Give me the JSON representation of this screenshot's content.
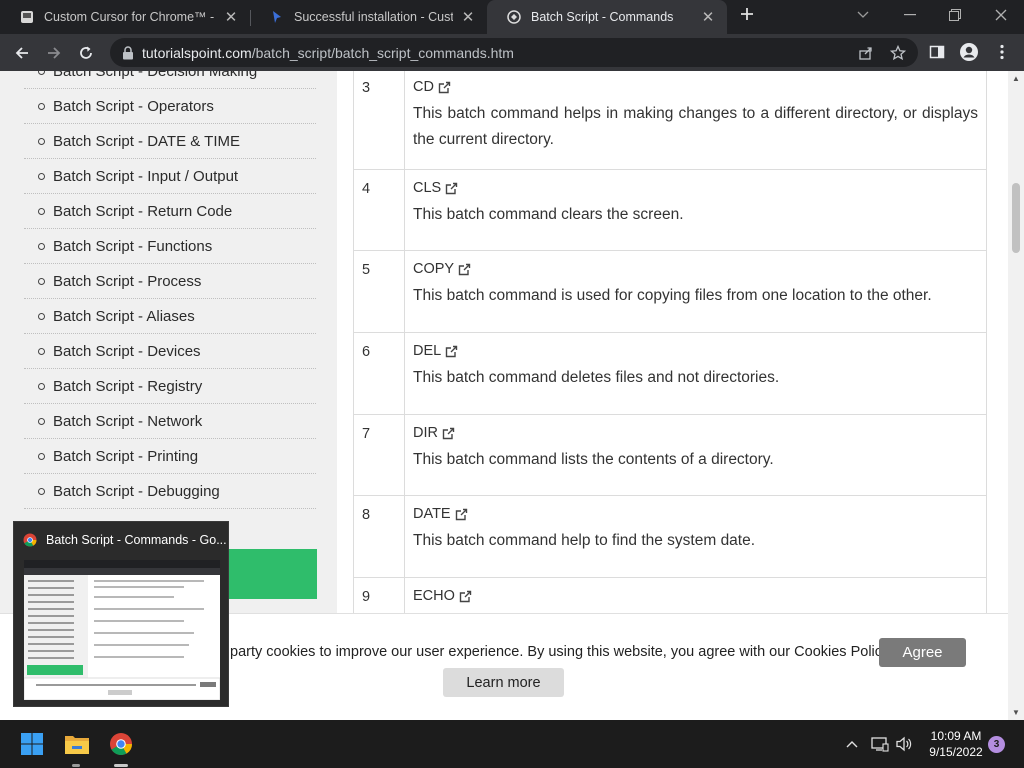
{
  "tabs": [
    {
      "title": "Custom Cursor for Chrome™ - Cu",
      "close": "✕"
    },
    {
      "title": "Successful installation - Custom C",
      "close": "✕"
    },
    {
      "title": "Batch Script - Commands",
      "close": "✕"
    }
  ],
  "toolbar": {
    "url_host": "tutorialspoint.com",
    "url_path": "/batch_script/batch_script_commands.htm"
  },
  "sidebar": {
    "items": [
      {
        "label": "Batch Script - Decision Making"
      },
      {
        "label": "Batch Script - Operators"
      },
      {
        "label": "Batch Script - DATE & TIME"
      },
      {
        "label": "Batch Script - Input / Output"
      },
      {
        "label": "Batch Script - Return Code"
      },
      {
        "label": "Batch Script - Functions"
      },
      {
        "label": "Batch Script - Process"
      },
      {
        "label": "Batch Script - Aliases"
      },
      {
        "label": "Batch Script - Devices"
      },
      {
        "label": "Batch Script - Registry"
      },
      {
        "label": "Batch Script - Network"
      },
      {
        "label": "Batch Script - Printing"
      },
      {
        "label": "Batch Script - Debugging"
      }
    ]
  },
  "commands": [
    {
      "num": "3",
      "name": "CD",
      "desc": "This batch command helps in making changes to a different directory, or displays the current directory."
    },
    {
      "num": "4",
      "name": "CLS",
      "desc": "This batch command clears the screen."
    },
    {
      "num": "5",
      "name": "COPY",
      "desc": "This batch command is used for copying files from one location to the other."
    },
    {
      "num": "6",
      "name": "DEL",
      "desc": "This batch command deletes files and not directories."
    },
    {
      "num": "7",
      "name": "DIR",
      "desc": "This batch command lists the contents of a directory."
    },
    {
      "num": "8",
      "name": "DATE",
      "desc": "This batch command help to find the system date."
    },
    {
      "num": "9",
      "name": "ECHO",
      "desc": ""
    }
  ],
  "cookie": {
    "text": "party cookies to improve our user experience. By using this website, you agree with our Cookies Policy.",
    "agree": "Agree",
    "learn_more": "Learn more"
  },
  "preview": {
    "title": "Batch Script - Commands - Go..."
  },
  "taskbar": {
    "time": "10:09 AM",
    "date": "9/15/2022",
    "notifications": "3"
  },
  "colors": {
    "accent_green": "#2fbd6b",
    "agree_button": "#7a7a7a",
    "tab_bar": "#202124",
    "toolbar": "#35363a"
  }
}
